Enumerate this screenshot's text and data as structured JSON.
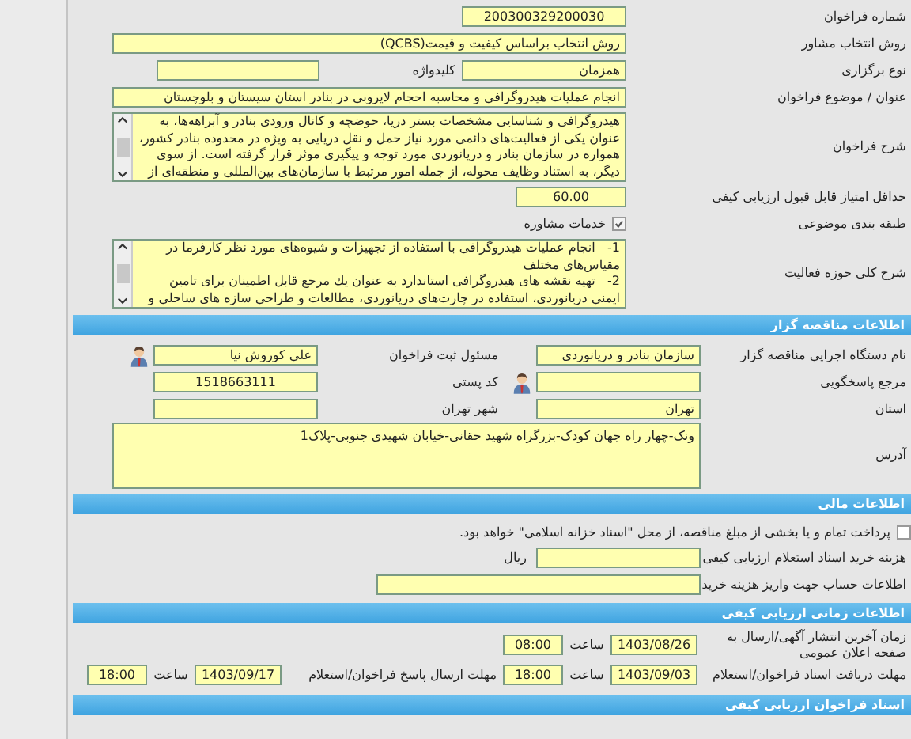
{
  "call_info": {
    "rows": [
      {
        "kind": "short",
        "label": "شماره فراخوان",
        "value": "200300329200030"
      },
      {
        "kind": "long",
        "label": "روش انتخاب مشاور",
        "value": "روش انتخاب براساس کیفیت و قیمت(QCBS)"
      },
      {
        "kind": "pair",
        "label": "نوع برگزاری",
        "value": "همزمان",
        "label_2": "کلیدواژه"
      },
      {
        "kind": "long",
        "label": "عنوان / موضوع فراخوان",
        "value": "انجام عملیات هیدروگرافی و محاسبه احجام لایروبی در بنادر استان سیستان و بلوچستان"
      },
      {
        "kind": "textarea",
        "label": "شرح فراخوان",
        "value": "هیدروگرافی و شناسایی مشخصات بستر دریا، حوضچه و کانال ورودی بنادر و آبراهه‌ها، به عنوان یکی از فعالیت‌های دائمی مورد نیاز حمل و نقل دریایی به ویژه در محدوده بنادر کشور، همواره در سازمان بنادر و دریانوردی مورد توجه و پیگیری موثر قرار گرفته است. از سوی دیگر، به استناد وظایف محوله، از جمله امور مرتبط با سازمان‌های بین‌المللی و منطقه‌ای از"
      },
      {
        "kind": "score",
        "label": "حداقل امتیاز قابل قبول ارزیابی کیفی",
        "value": "60.00"
      },
      {
        "kind": "category",
        "label": "طبقه بندی موضوعی",
        "value": "خدمات مشاوره",
        "checked": true
      },
      {
        "kind": "list",
        "label": "شرح کلی حوزه فعالیت",
        "items": [
          "1-   انجام عملیات هیدروگرافی با استفاده از تجهیزات و شیوه‌های مورد نظر کارفرما در مقیاس‌های مختلف",
          "2-   تهیه نقشه های هیدروگرافی استاندارد به عنوان یك مرجع قابل اطمینان برای تامین ایمنی دریانوردی، استفاده در چارت‌های دریانوردی، مطالعات و طراحی سازه های ساحلی و"
        ]
      }
    ]
  },
  "organizer": {
    "title": "اطلاعات مناقصه گزار",
    "rows": [
      {
        "label": "نام دستگاه اجرایی مناقصه گزار",
        "value": "سازمان بنادر و دریانوردی",
        "label_2": "مسئول ثبت فراخوان",
        "value_2": "علی کوروش نیا"
      },
      {
        "label": "مرجع پاسخگویی",
        "label_2": "کد پستی",
        "value_2": "1518663111"
      },
      {
        "label": "استان",
        "value": "تهران",
        "label_2": "شهر تهران"
      }
    ],
    "address": {
      "label": "آدرس",
      "value": "ونک-چهار راه جهان کودک-بزرگراه شهید حقانی-خیابان شهیدی جنوبی-پلاک1"
    }
  },
  "financial": {
    "title": "اطلاعات مالی",
    "treasury_bonds": {
      "checked": false,
      "text": "پرداخت تمام و یا بخشی از مبلغ مناقصه، از محل \"اسناد خزانه اسلامی\" خواهد بود."
    },
    "document_fee": {
      "label": "هزینه خرید اسناد استعلام ارزیابی کیفی",
      "unit": "ریال"
    },
    "account": {
      "label": "اطلاعات حساب جهت واریز هزینه خرید"
    }
  },
  "timing": {
    "title": "اطلاعات زمانی ارزیابی کیفی",
    "rows": [
      {
        "entries": [
          {
            "label": "زمان آخرین انتشار آگهی/ارسال به صفحه اعلان عمومی",
            "date": "1403/08/26",
            "time_label": "ساعت",
            "time": "08:00"
          }
        ]
      },
      {
        "entries": [
          {
            "label": "مهلت دریافت اسناد فراخوان/استعلام",
            "date": "1403/09/03",
            "time_label": "ساعت",
            "time": "18:00"
          },
          {
            "label": "مهلت ارسال پاسخ فراخوان/استعلام",
            "date": "1403/09/17",
            "time_label": "ساعت",
            "time": "18:00"
          }
        ]
      }
    ]
  },
  "documents": {
    "title": "اسناد فراخوان ارزیابی کیفی"
  }
}
